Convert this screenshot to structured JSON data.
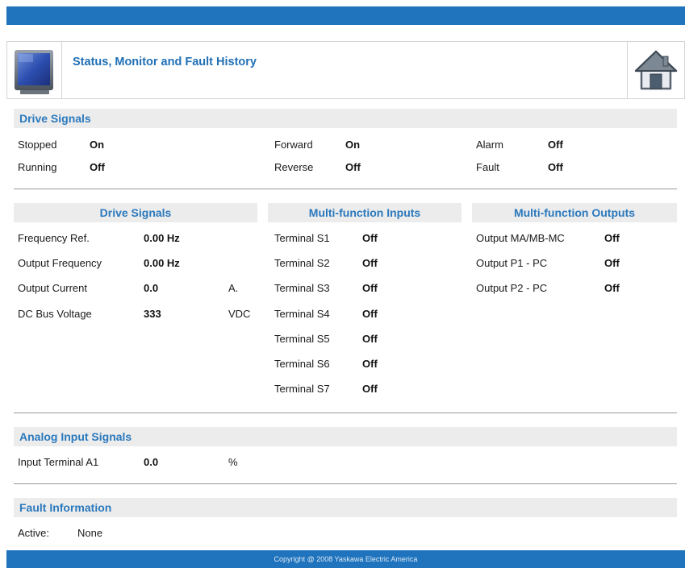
{
  "header": {
    "title": "Status, Monitor and Fault History",
    "left_icon": "monitor-icon",
    "right_icon": "home-icon"
  },
  "drive_signals_top": {
    "heading": "Drive Signals",
    "items": [
      {
        "label": "Stopped",
        "value": "On"
      },
      {
        "label": "Running",
        "value": "Off"
      },
      {
        "label": "Forward",
        "value": "On"
      },
      {
        "label": "Reverse",
        "value": "Off"
      },
      {
        "label": "Alarm",
        "value": "Off"
      },
      {
        "label": "Fault",
        "value": "Off"
      }
    ]
  },
  "drive_signals": {
    "heading": "Drive Signals",
    "rows": [
      {
        "label": "Frequency Ref.",
        "value": "0.00 Hz",
        "unit": ""
      },
      {
        "label": "Output Frequency",
        "value": "0.00 Hz",
        "unit": ""
      },
      {
        "label": "Output Current",
        "value": "0.0",
        "unit": "A."
      },
      {
        "label": "DC Bus Voltage",
        "value": "333",
        "unit": "VDC"
      }
    ]
  },
  "mf_inputs": {
    "heading": "Multi-function Inputs",
    "rows": [
      {
        "label": "Terminal S1",
        "value": "Off"
      },
      {
        "label": "Terminal S2",
        "value": "Off"
      },
      {
        "label": "Terminal S3",
        "value": "Off"
      },
      {
        "label": "Terminal S4",
        "value": "Off"
      },
      {
        "label": "Terminal S5",
        "value": "Off"
      },
      {
        "label": "Terminal S6",
        "value": "Off"
      },
      {
        "label": "Terminal S7",
        "value": "Off"
      }
    ]
  },
  "mf_outputs": {
    "heading": "Multi-function Outputs",
    "rows": [
      {
        "label": "Output MA/MB-MC",
        "value": "Off"
      },
      {
        "label": "Output P1 - PC",
        "value": "Off"
      },
      {
        "label": "Output P2 - PC",
        "value": "Off"
      }
    ]
  },
  "analog_inputs": {
    "heading": "Analog Input Signals",
    "rows": [
      {
        "label": "Input Terminal A1",
        "value": "0.0",
        "unit": "%"
      }
    ]
  },
  "fault_info": {
    "heading": "Fault Information",
    "active_label": "Active:",
    "active_value": "None"
  },
  "footer": {
    "copyright": "Copyright @ 2008 Yaskawa Electric America"
  },
  "colors": {
    "brand_blue": "#1f74bd",
    "heading_blue": "#2b79bd",
    "section_bg": "#ececec"
  }
}
